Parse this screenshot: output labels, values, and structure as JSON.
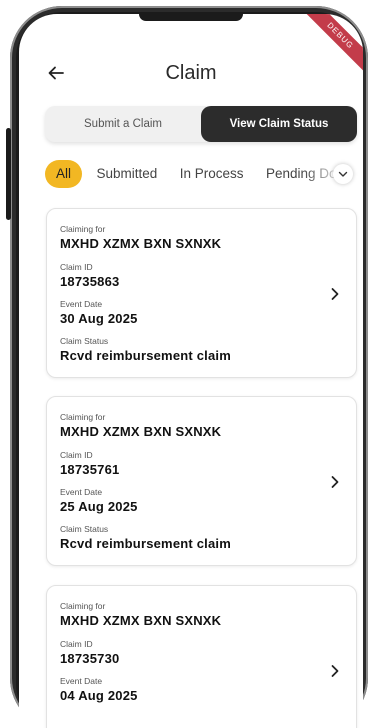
{
  "ribbon": {
    "text": "DEBUG"
  },
  "header": {
    "title": "Claim"
  },
  "segmented": {
    "left_label": "Submit a Claim",
    "right_label": "View Claim Status",
    "active": "View Claim Status"
  },
  "filters": {
    "items": [
      "All",
      "Submitted",
      "In Process",
      "Pending Do"
    ],
    "active": "All"
  },
  "colors": {
    "accent": "#f2b723",
    "dark": "#2c2c2c"
  },
  "claims": [
    {
      "claiming_for_label": "Claiming for",
      "claiming_for": "MXHD XZMX BXN SXNXK",
      "claim_id_label": "Claim ID",
      "claim_id": "18735863",
      "event_date_label": "Event Date",
      "event_date": "30 Aug 2025",
      "status_label": "Claim Status",
      "status": "Rcvd reimbursement claim"
    },
    {
      "claiming_for_label": "Claiming for",
      "claiming_for": "MXHD XZMX BXN SXNXK",
      "claim_id_label": "Claim ID",
      "claim_id": "18735761",
      "event_date_label": "Event Date",
      "event_date": "25 Aug 2025",
      "status_label": "Claim Status",
      "status": "Rcvd reimbursement claim"
    },
    {
      "claiming_for_label": "Claiming for",
      "claiming_for": "MXHD XZMX BXN SXNXK",
      "claim_id_label": "Claim ID",
      "claim_id": "18735730",
      "event_date_label": "Event Date",
      "event_date": "04 Aug 2025"
    }
  ]
}
